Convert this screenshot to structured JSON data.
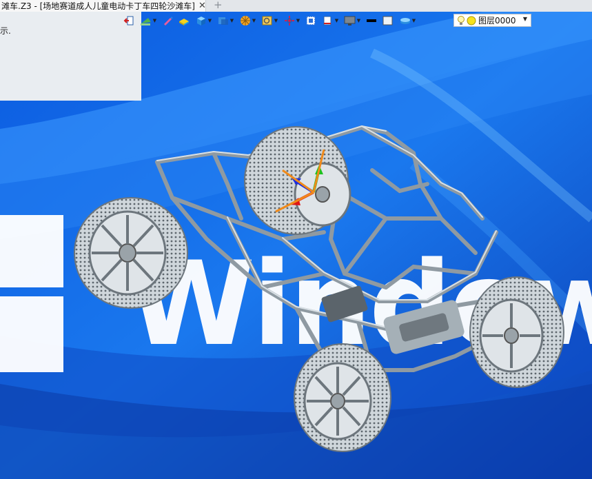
{
  "tab": {
    "title": "滩车.Z3 - [场地赛道成人儿童电动卡丁车四轮沙滩车]",
    "close_glyph": "✕",
    "new_tab_glyph": "+"
  },
  "hint": {
    "text": "示."
  },
  "toolbar": {
    "buttons": [
      {
        "icon": "exit-icon",
        "dropdown": false
      },
      {
        "icon": "clean-icon",
        "dropdown": true
      },
      {
        "icon": "pencil-icon",
        "dropdown": false
      },
      {
        "icon": "yellow-solid-icon",
        "dropdown": false
      },
      {
        "icon": "cube-icon",
        "dropdown": true
      },
      {
        "icon": "view-cube-icon",
        "dropdown": true
      },
      {
        "icon": "render-mode-icon",
        "dropdown": true
      },
      {
        "icon": "zoom-fit-icon",
        "dropdown": true
      },
      {
        "icon": "pan-icon",
        "dropdown": true
      },
      {
        "icon": "select-icon",
        "dropdown": false
      },
      {
        "icon": "align-icon",
        "dropdown": true
      },
      {
        "icon": "monitor-icon",
        "dropdown": true
      },
      {
        "icon": "line-color-icon",
        "dropdown": false
      },
      {
        "icon": "fill-color-icon",
        "dropdown": false
      },
      {
        "icon": "layer-stack-icon",
        "dropdown": true
      }
    ],
    "layer": {
      "value": "图层0000",
      "caret": "▼"
    }
  },
  "wallpaper": {
    "text": "Windows"
  },
  "colors": {
    "desktop_blue": "#1a5fd8",
    "frame_gray": "#b9c4cc",
    "toolbar_bg": "#e9edf1"
  }
}
